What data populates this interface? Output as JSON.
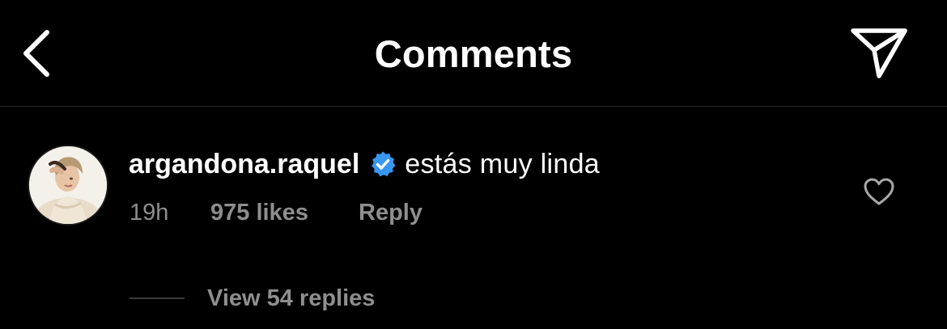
{
  "header": {
    "title": "Comments",
    "back_icon": "chevron-left-icon",
    "share_icon": "paper-plane-icon"
  },
  "comment": {
    "username": "argandona.raquel",
    "verified": true,
    "text": "estás muy linda",
    "time": "19h",
    "likes": "975 likes",
    "reply_label": "Reply",
    "like_icon": "heart-outline-icon",
    "view_replies": "View 54 replies"
  },
  "colors": {
    "background": "#000000",
    "text_primary": "#ffffff",
    "text_secondary": "#8e8e8e",
    "verified_badge": "#3897f0",
    "divider": "#262626"
  }
}
